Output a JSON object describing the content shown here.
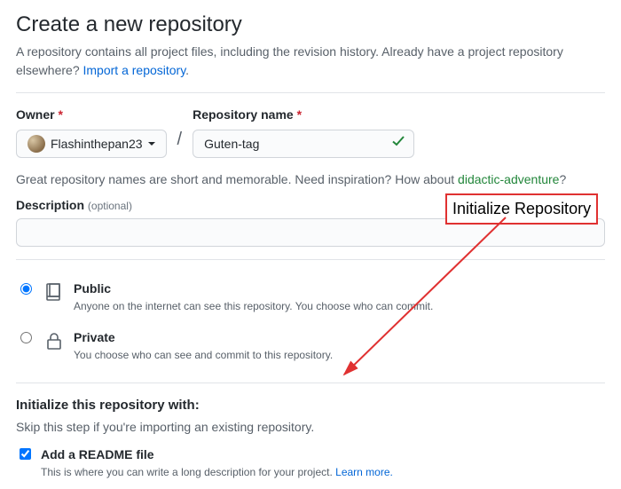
{
  "page": {
    "title": "Create a new repository",
    "subtitle_prefix": "A repository contains all project files, including the revision history. Already have a project repository elsewhere? ",
    "import_link": "Import a repository"
  },
  "form": {
    "owner_label": "Owner",
    "owner_value": "Flashinthepan23",
    "repo_label": "Repository name",
    "repo_value": "Guten-tag",
    "hint_prefix": "Great repository names are short and memorable. Need inspiration? How about ",
    "hint_suggestion": "didactic-adventure",
    "hint_suffix": "?",
    "description_label": "Description",
    "optional_text": "(optional)",
    "description_value": ""
  },
  "visibility": {
    "public": {
      "title": "Public",
      "desc": "Anyone on the internet can see this repository. You choose who can commit."
    },
    "private": {
      "title": "Private",
      "desc": "You choose who can see and commit to this repository."
    }
  },
  "initialize": {
    "heading": "Initialize this repository with:",
    "sub": "Skip this step if you're importing an existing repository.",
    "readme_title": "Add a README file",
    "readme_desc_prefix": "This is where you can write a long description for your project. ",
    "readme_learn": "Learn more."
  },
  "annotation": {
    "label": "Initialize Repository"
  }
}
